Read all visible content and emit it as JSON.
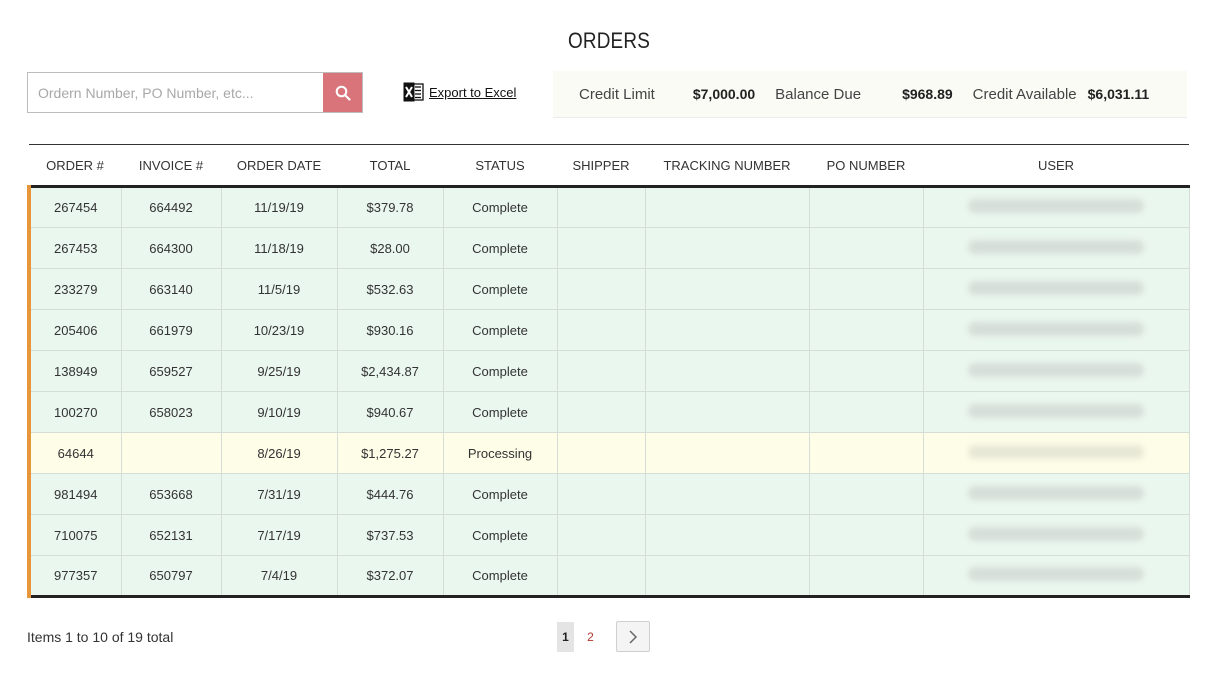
{
  "page_title": "ORDERS",
  "search": {
    "placeholder": "Ordern Number, PO Number, etc..."
  },
  "export": {
    "label": "Export to Excel"
  },
  "credit": {
    "limit_label": "Credit Limit",
    "limit_value": "$7,000.00",
    "balance_label": "Balance Due",
    "balance_value": "$968.89",
    "available_label": "Credit Available",
    "available_value": "$6,031.11"
  },
  "table": {
    "headers": [
      "ORDER #",
      "INVOICE #",
      "ORDER DATE",
      "TOTAL",
      "STATUS",
      "SHIPPER",
      "TRACKING NUMBER",
      "PO NUMBER",
      "USER"
    ],
    "rows": [
      {
        "order": "267454",
        "invoice": "664492",
        "date": "11/19/19",
        "total": "$379.78",
        "status": "Complete",
        "shipper": "",
        "tracking": "",
        "po": ""
      },
      {
        "order": "267453",
        "invoice": "664300",
        "date": "11/18/19",
        "total": "$28.00",
        "status": "Complete",
        "shipper": "",
        "tracking": "",
        "po": ""
      },
      {
        "order": "233279",
        "invoice": "663140",
        "date": "11/5/19",
        "total": "$532.63",
        "status": "Complete",
        "shipper": "",
        "tracking": "",
        "po": ""
      },
      {
        "order": "205406",
        "invoice": "661979",
        "date": "10/23/19",
        "total": "$930.16",
        "status": "Complete",
        "shipper": "",
        "tracking": "",
        "po": ""
      },
      {
        "order": "138949",
        "invoice": "659527",
        "date": "9/25/19",
        "total": "$2,434.87",
        "status": "Complete",
        "shipper": "",
        "tracking": "",
        "po": ""
      },
      {
        "order": "100270",
        "invoice": "658023",
        "date": "9/10/19",
        "total": "$940.67",
        "status": "Complete",
        "shipper": "",
        "tracking": "",
        "po": ""
      },
      {
        "order": "64644",
        "invoice": "",
        "date": "8/26/19",
        "total": "$1,275.27",
        "status": "Processing",
        "shipper": "",
        "tracking": "",
        "po": ""
      },
      {
        "order": "981494",
        "invoice": "653668",
        "date": "7/31/19",
        "total": "$444.76",
        "status": "Complete",
        "shipper": "",
        "tracking": "",
        "po": ""
      },
      {
        "order": "710075",
        "invoice": "652131",
        "date": "7/17/19",
        "total": "$737.53",
        "status": "Complete",
        "shipper": "",
        "tracking": "",
        "po": ""
      },
      {
        "order": "977357",
        "invoice": "650797",
        "date": "7/4/19",
        "total": "$372.07",
        "status": "Complete",
        "shipper": "",
        "tracking": "",
        "po": ""
      }
    ]
  },
  "footer": {
    "items_summary": "Items 1 to 10 of 19 total"
  },
  "pagination": {
    "pages": [
      "1",
      "2"
    ],
    "current": "1"
  },
  "colors": {
    "search_button": "#d9747a",
    "row_accent": "#e8963c",
    "row_complete_bg": "#eaf7ee",
    "row_processing_bg": "#fdfde8",
    "credit_panel_bg": "#fbfbf5"
  },
  "icons": {
    "search": "search-icon",
    "export": "excel-icon",
    "next": "chevron-right-icon"
  }
}
